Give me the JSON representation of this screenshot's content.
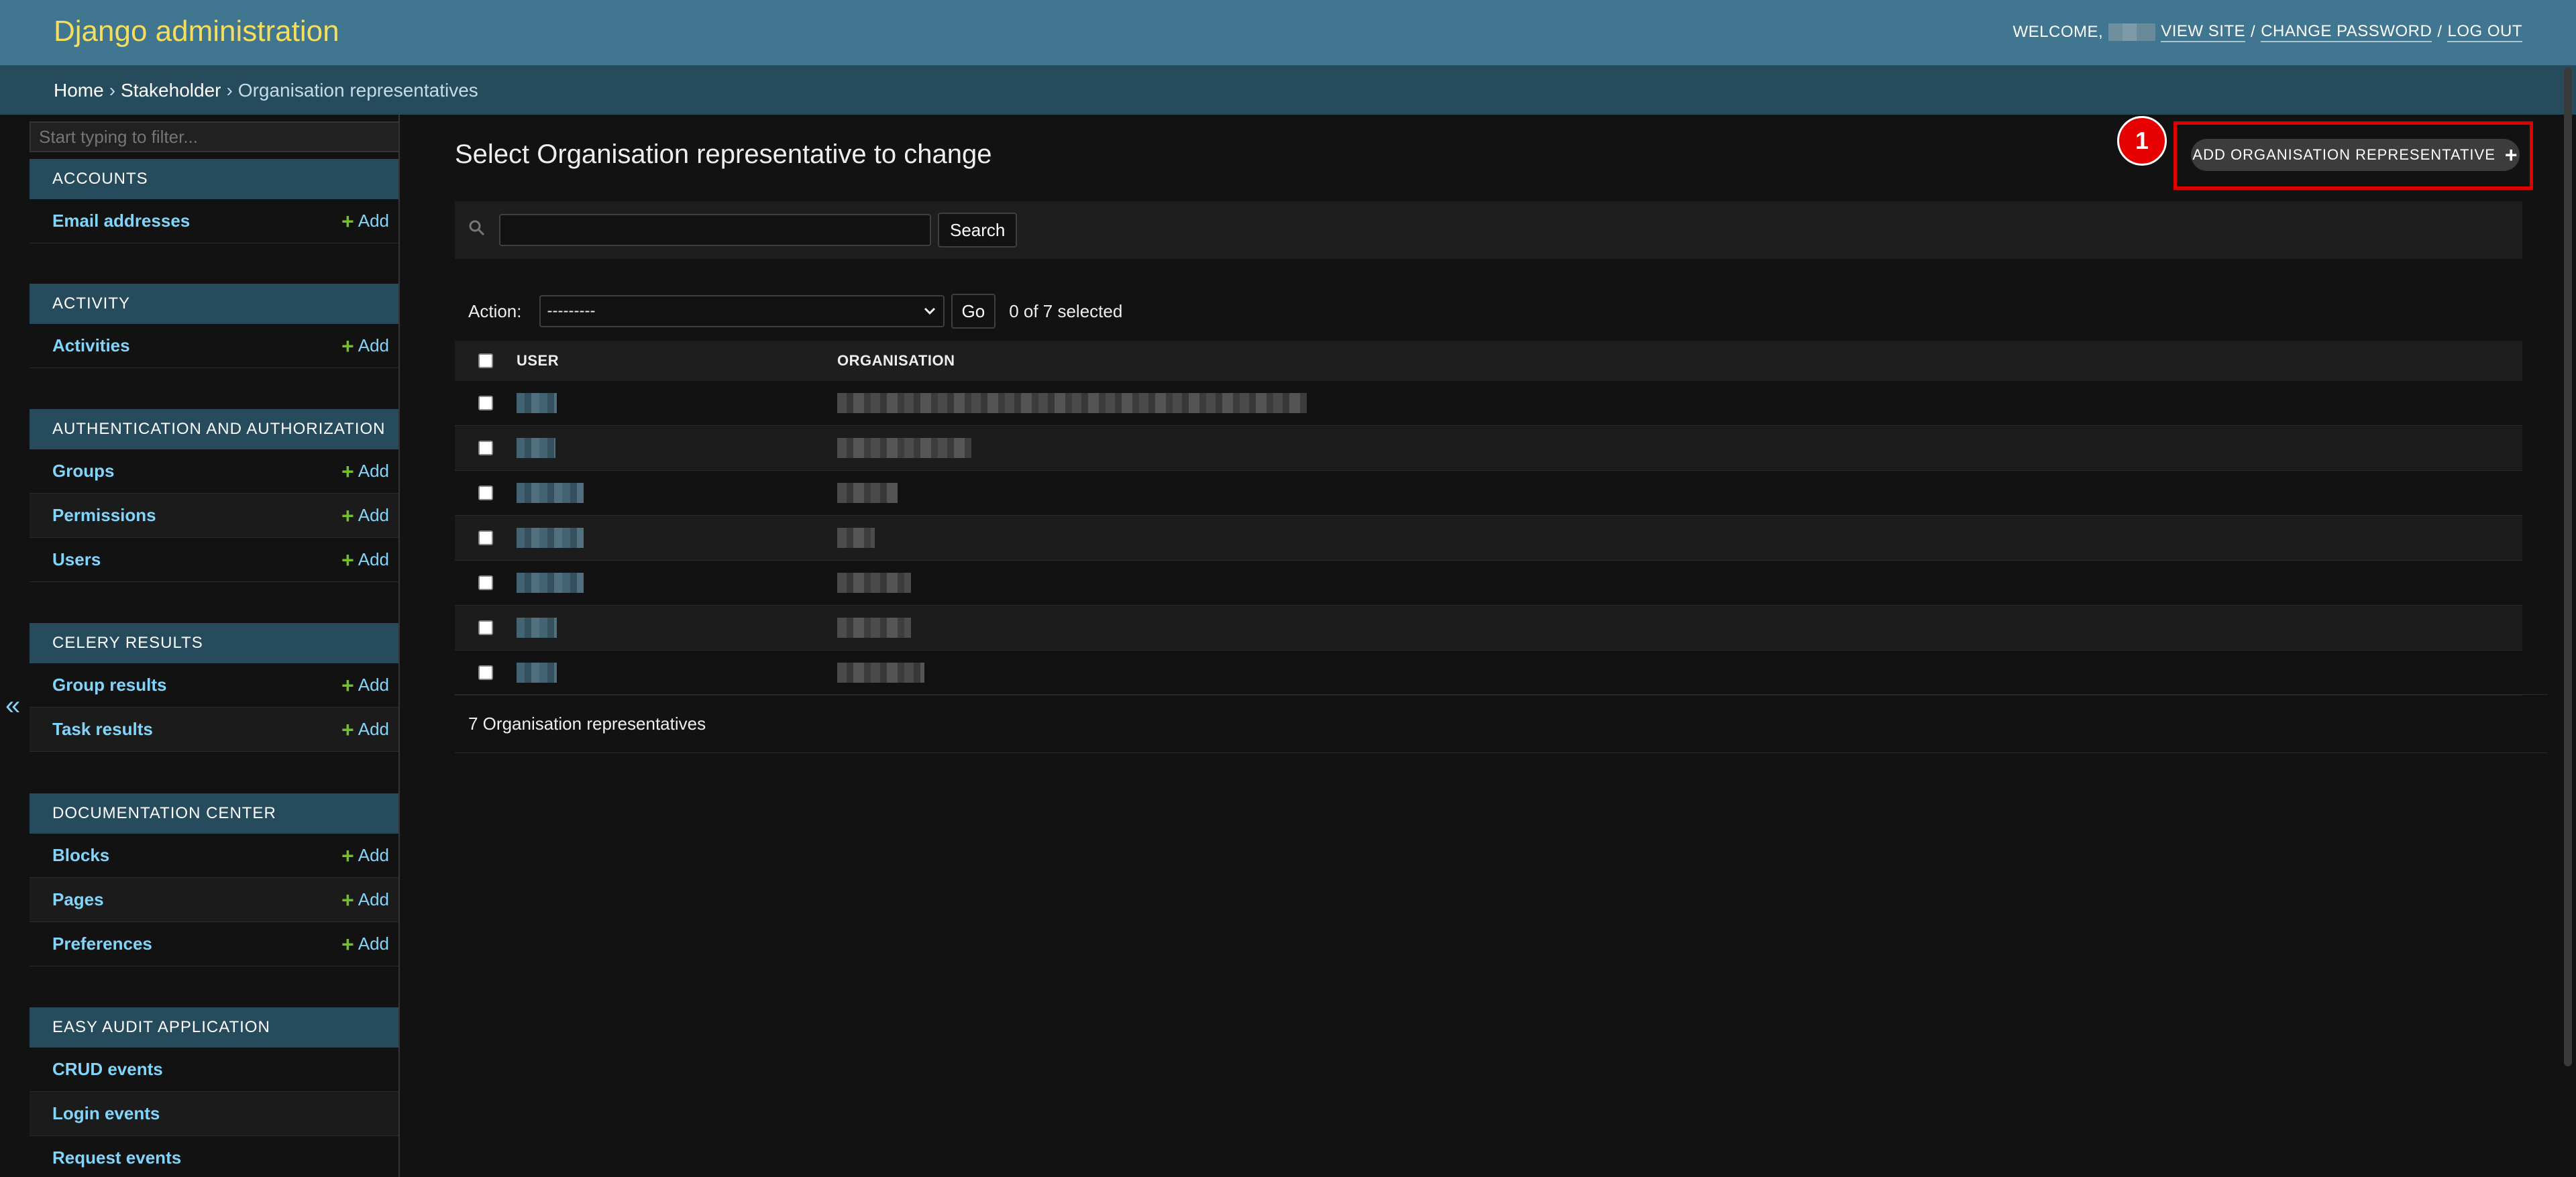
{
  "header": {
    "site_name": "Django administration",
    "welcome": "WELCOME,",
    "view_site": "VIEW SITE",
    "change_password": "CHANGE PASSWORD",
    "log_out": "LOG OUT",
    "sep": "/"
  },
  "breadcrumbs": {
    "items": [
      "Home",
      "Stakeholder",
      "Organisation representatives"
    ],
    "sep": "›"
  },
  "sidebar": {
    "filter_placeholder": "Start typing to filter...",
    "toggle_label": "«",
    "add_label": "Add",
    "apps": [
      {
        "caption": "ACCOUNTS",
        "models": [
          {
            "name": "Email addresses",
            "add": true
          }
        ]
      },
      {
        "caption": "ACTIVITY",
        "models": [
          {
            "name": "Activities",
            "add": true
          }
        ]
      },
      {
        "caption": "AUTHENTICATION AND AUTHORIZATION",
        "models": [
          {
            "name": "Groups",
            "add": true
          },
          {
            "name": "Permissions",
            "add": true
          },
          {
            "name": "Users",
            "add": true
          }
        ]
      },
      {
        "caption": "CELERY RESULTS",
        "models": [
          {
            "name": "Group results",
            "add": true
          },
          {
            "name": "Task results",
            "add": true
          }
        ]
      },
      {
        "caption": "DOCUMENTATION CENTER",
        "models": [
          {
            "name": "Blocks",
            "add": true
          },
          {
            "name": "Pages",
            "add": true
          },
          {
            "name": "Preferences",
            "add": true
          }
        ]
      },
      {
        "caption": "EASY AUDIT APPLICATION",
        "models": [
          {
            "name": "CRUD events",
            "add": false
          },
          {
            "name": "Login events",
            "add": false
          },
          {
            "name": "Request events",
            "add": false
          }
        ]
      }
    ]
  },
  "content": {
    "title": "Select Organisation representative to change",
    "add_button": "ADD ORGANISATION REPRESENTATIVE",
    "annotation_badge": "1",
    "search_button": "Search",
    "search_value": "",
    "action_label": "Action:",
    "action_selected": "---------",
    "go_button": "Go",
    "selected_count": "0 of 7 selected",
    "columns": [
      "USER",
      "ORGANISATION"
    ],
    "row_count": 7,
    "paginator": "7 Organisation representatives"
  },
  "colors": {
    "header_bg": "#417690",
    "breadcrumb_bg": "#264b5d",
    "site_name": "#f5dd5d",
    "link": "#81d4fa",
    "add_plus": "#70bf2b",
    "highlight": "#e00000"
  }
}
